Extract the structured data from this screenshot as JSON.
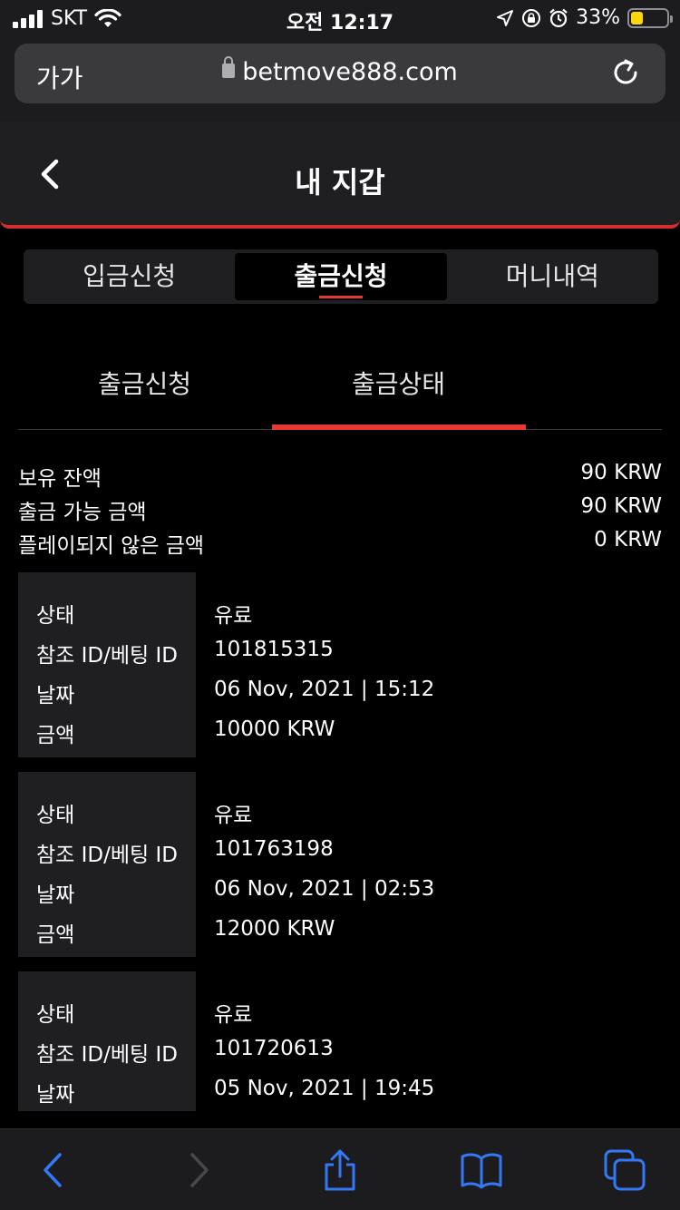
{
  "status_bar": {
    "carrier": "SKT",
    "time": "오전 12:17",
    "battery": "33%",
    "battery_level": 0.33
  },
  "browser": {
    "aa_label": "가가",
    "url": "betmove888.com"
  },
  "header": {
    "title": "내 지갑"
  },
  "main_tabs": [
    {
      "label": "입금신청",
      "active": false
    },
    {
      "label": "출금신청",
      "active": true
    },
    {
      "label": "머니내역",
      "active": false
    }
  ],
  "sub_tabs": [
    {
      "label": "출금신청",
      "active": false
    },
    {
      "label": "출금상태",
      "active": true
    }
  ],
  "balance": [
    {
      "label": "보유 잔액",
      "value": "90 KRW"
    },
    {
      "label": "출금 가능 금액",
      "value": "90 KRW"
    },
    {
      "label": "플레이되지 않은 금액",
      "value": "0 KRW"
    }
  ],
  "record_labels": {
    "status": "상태",
    "ref_id": "참조 ID/베팅 ID",
    "date": "날짜",
    "amount": "금액"
  },
  "records": [
    {
      "status": "유료",
      "ref_id": "101815315",
      "date": "06 Nov, 2021 | 15:12",
      "amount": "10000 KRW"
    },
    {
      "status": "유료",
      "ref_id": "101763198",
      "date": "06 Nov, 2021 | 02:53",
      "amount": "12000 KRW"
    },
    {
      "status": "유료",
      "ref_id": "101720613",
      "date": "05 Nov, 2021 | 19:45"
    }
  ],
  "colors": {
    "accent_red": "#e53935",
    "safari_blue": "#3478f6",
    "panel": "#1f1f22"
  },
  "toolbar_icons": [
    "back-icon",
    "forward-icon",
    "share-icon",
    "bookmarks-icon",
    "tabs-icon"
  ]
}
